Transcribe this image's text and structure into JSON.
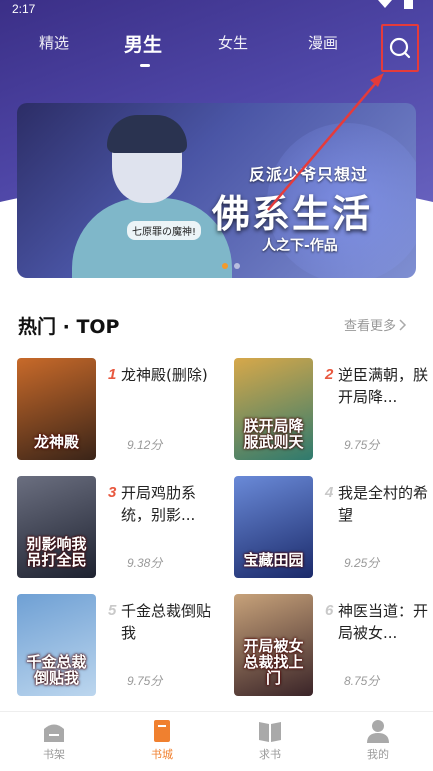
{
  "status_bar": {
    "time": "2:17"
  },
  "top_nav": {
    "tabs": [
      {
        "label": "精选"
      },
      {
        "label": "男生",
        "active": true
      },
      {
        "label": "女生"
      },
      {
        "label": "漫画"
      }
    ],
    "search_icon": "search-icon"
  },
  "banner": {
    "subtitle": "反派少爷只想过",
    "title": "佛系生活",
    "author_line": "人之下-作品",
    "bubble": "七原罪の魔神!",
    "slides_total": 2,
    "slide_active": 1,
    "accent": "#f39a2b"
  },
  "section": {
    "title": "热门 · TOP",
    "more_label": "查看更多",
    "books": [
      {
        "rank": "1",
        "title": "龙神殿(删除)",
        "score": "9.12分",
        "cover_text": "龙神殿",
        "cover_colors": [
          "#3a2418",
          "#c86a2a"
        ]
      },
      {
        "rank": "2",
        "title": "逆臣满朝，朕开局降...",
        "score": "9.75分",
        "cover_text": "朕开局降服武则天",
        "cover_colors": [
          "#2e7a6e",
          "#d7a84a"
        ]
      },
      {
        "rank": "3",
        "title": "开局鸡肋系统，别影...",
        "score": "9.38分",
        "cover_text": "别影响我吊打全民",
        "cover_colors": [
          "#1e2230",
          "#6b6f80"
        ]
      },
      {
        "rank": "4",
        "title": "我是全村的希望",
        "score": "9.25分",
        "cover_text": "宝藏田园",
        "cover_colors": [
          "#1b2a6a",
          "#6a8ad8"
        ]
      },
      {
        "rank": "5",
        "title": "千金总裁倒贴我",
        "score": "9.75分",
        "cover_text": "千金总裁倒贴我",
        "cover_colors": [
          "#bcd6ee",
          "#6fa0d4"
        ]
      },
      {
        "rank": "6",
        "title": "神医当道：开局被女...",
        "score": "8.75分",
        "cover_text": "开局被女总裁找上门",
        "cover_colors": [
          "#3a2428",
          "#c7a27a"
        ]
      }
    ],
    "rank_colors": {
      "top": "#e8583f",
      "other": "#c9c9c9"
    }
  },
  "tabbar": {
    "items": [
      {
        "label": "书架",
        "icon": "bookshelf-icon"
      },
      {
        "label": "书城",
        "icon": "bookstore-icon",
        "active": true
      },
      {
        "label": "求书",
        "icon": "open-book-icon"
      },
      {
        "label": "我的",
        "icon": "person-icon"
      }
    ],
    "active_color": "#f0802f"
  },
  "annotation": {
    "highlight_color": "#e53b3b"
  }
}
